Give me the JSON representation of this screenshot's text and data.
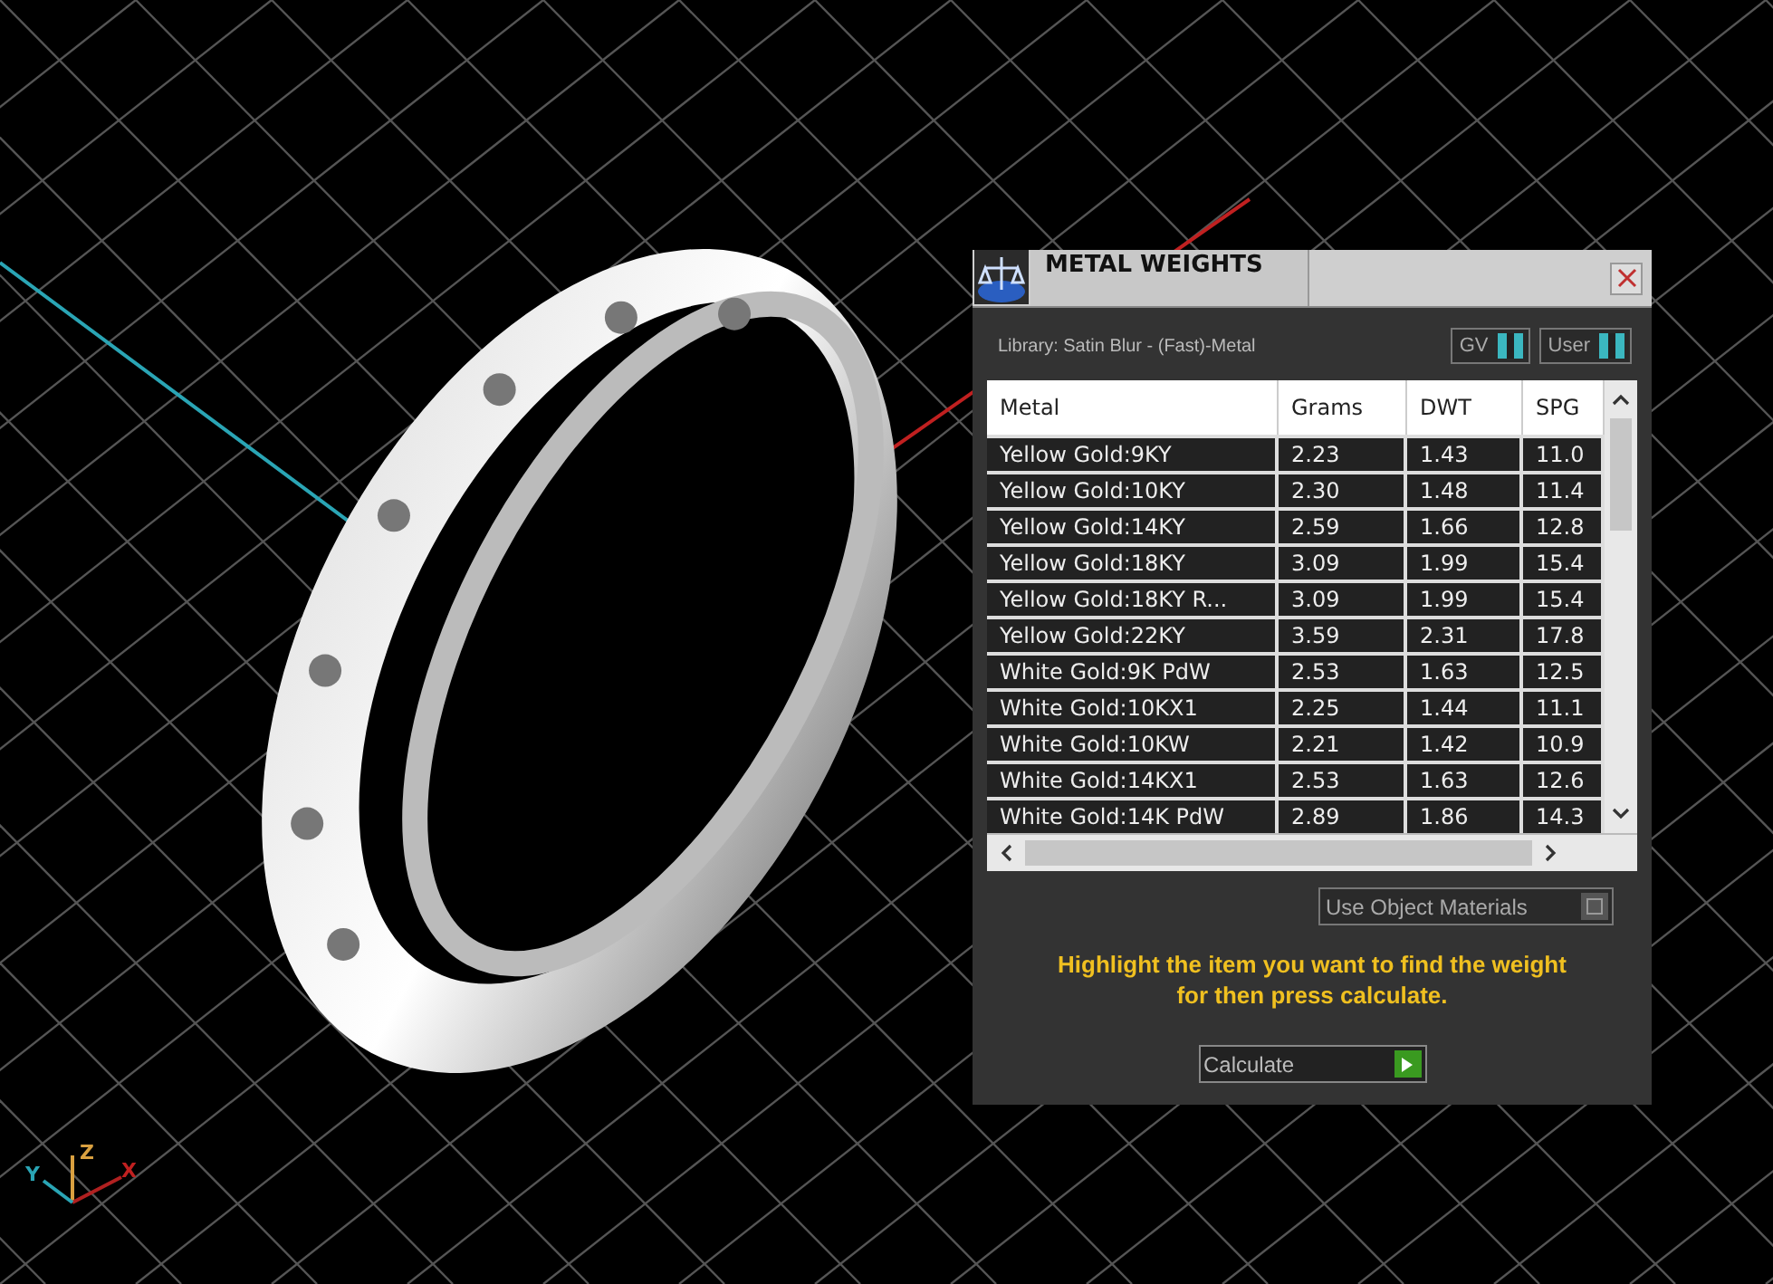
{
  "viewport": {
    "axis_labels": [
      "Y",
      "Z",
      "X"
    ]
  },
  "panel": {
    "title": "METAL WEIGHTS",
    "library": "Library: Satin Blur - (Fast)-Metal",
    "toggles": [
      {
        "label": "GV",
        "on": true
      },
      {
        "label": "User",
        "on": true
      }
    ],
    "table": {
      "columns": [
        "Metal",
        "Grams",
        "DWT",
        "SPG"
      ],
      "rows": [
        [
          "Yellow Gold:9KY",
          "2.23",
          "1.43",
          "11.0"
        ],
        [
          "Yellow Gold:10KY",
          "2.30",
          "1.48",
          "11.4"
        ],
        [
          "Yellow Gold:14KY",
          "2.59",
          "1.66",
          "12.8"
        ],
        [
          "Yellow Gold:18KY",
          "3.09",
          "1.99",
          "15.4"
        ],
        [
          "Yellow Gold:18KY R...",
          "3.09",
          "1.99",
          "15.4"
        ],
        [
          "Yellow Gold:22KY",
          "3.59",
          "2.31",
          "17.8"
        ],
        [
          "White Gold:9K PdW",
          "2.53",
          "1.63",
          "12.5"
        ],
        [
          "White Gold:10KX1",
          "2.25",
          "1.44",
          "11.1"
        ],
        [
          "White Gold:10KW",
          "2.21",
          "1.42",
          "10.9"
        ],
        [
          "White Gold:14KX1",
          "2.53",
          "1.63",
          "12.6"
        ],
        [
          "White Gold:14K PdW",
          "2.89",
          "1.86",
          "14.3"
        ]
      ]
    },
    "use_object_materials": {
      "label": "Use Object Materials",
      "on": false
    },
    "hint": "Highlight the item you want to find the weight for then press calculate.",
    "calculate_button": "Calculate"
  }
}
